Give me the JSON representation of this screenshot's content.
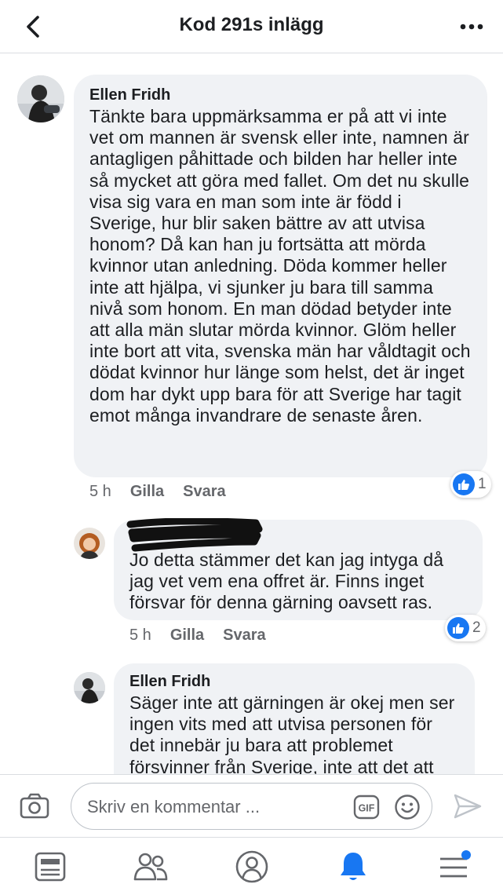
{
  "header": {
    "title": "Kod 291s inlägg"
  },
  "comments": [
    {
      "author": "Ellen Fridh",
      "text": "Tänkte bara uppmärksamma er på att vi inte vet om mannen är svensk eller inte, namnen är antagligen påhittade och bilden har heller inte så mycket att göra med fallet. Om det nu skulle visa sig vara en man som inte är född i Sverige, hur blir saken bättre av att utvisa honom? Då kan han ju fortsätta att mörda kvinnor utan anledning. Döda kommer heller inte att hjälpa, vi sjunker ju bara till samma nivå som honom. En man dödad betyder inte att alla män slutar mörda kvinnor. Glöm heller inte bort att vita, svenska män har våldtagit och dödat kvinnor hur länge som helst, det är inget dom har dykt upp bara för att Sverige har tagit emot många invandrare de senaste åren.",
      "time": "5 h",
      "like_label": "Gilla",
      "reply_label": "Svara",
      "reaction_count": "1"
    },
    {
      "author": "",
      "text": "Jo detta stämmer det kan jag intyga då jag vet vem ena offret är. Finns inget försvar för denna gärning oavsett ras.",
      "time": "5 h",
      "like_label": "Gilla",
      "reply_label": "Svara",
      "reaction_count": "2"
    },
    {
      "author": "Ellen Fridh",
      "text": "Säger inte att gärningen är okej men ser ingen vits med att utvisa personen för det innebär ju bara att problemet försvinner från Sverige, inte att det att"
    }
  ],
  "composer": {
    "placeholder": "Skriv en kommentar ...",
    "gif_label": "GIF"
  },
  "tabbar": {
    "items": [
      "news-feed",
      "friends",
      "profile",
      "notifications",
      "menu"
    ],
    "active": "notifications"
  },
  "colors": {
    "accent": "#1877f2",
    "bubble": "#f0f2f5",
    "meta": "#65676b"
  }
}
